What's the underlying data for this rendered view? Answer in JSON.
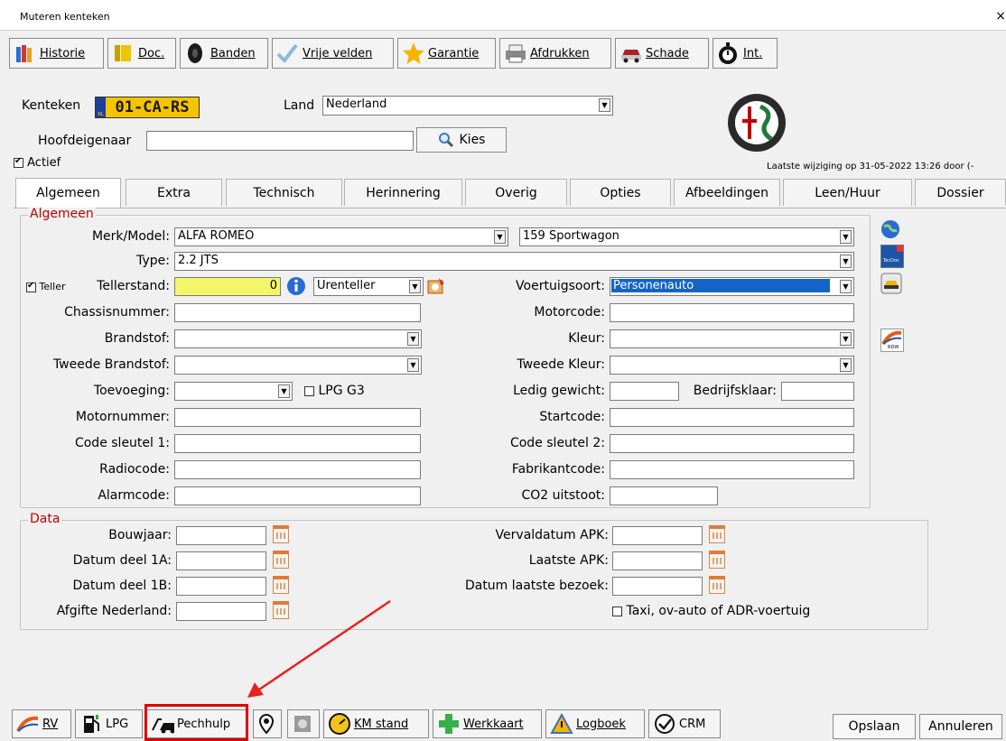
{
  "window": {
    "title": "Muteren kenteken",
    "close_glyph": "×"
  },
  "toolbar": {
    "items": [
      {
        "label": "Historie",
        "icon": "books-icon"
      },
      {
        "label": "Doc.",
        "icon": "binder-icon"
      },
      {
        "label": "Banden",
        "icon": "tire-icon"
      },
      {
        "label": "Vrije velden",
        "icon": "checkmark-icon"
      },
      {
        "label": "Garantie",
        "icon": "star-icon"
      },
      {
        "label": "Afdrukken",
        "icon": "printer-icon"
      },
      {
        "label": "Schade",
        "icon": "damaged-car-icon"
      },
      {
        "label": "Int.",
        "icon": "stopwatch-icon"
      }
    ]
  },
  "header": {
    "kenteken_label": "Kenteken",
    "plate_value": "01-CA-RS",
    "plate_country": "NL",
    "land_label": "Land",
    "land_value": "Nederland",
    "hoofdeigenaar_label": "Hoofdeigenaar",
    "hoofdeigenaar_value": "",
    "kies_label": "Kies",
    "actief_label": "Actief",
    "actief_checked": true,
    "laatste_wijziging": "Laatste wijziging op 31-05-2022 13:26 door (-"
  },
  "tabs": [
    "Algemeen",
    "Extra",
    "Technisch",
    "Herinnering",
    "Overig",
    "Opties",
    "Afbeeldingen",
    "Leen/Huur",
    "Dossier"
  ],
  "active_tab": "Algemeen",
  "algemeen": {
    "title": "Algemeen",
    "merk_model_label": "Merk/Model:",
    "merk_value": "ALFA ROMEO",
    "model_value": "159 Sportwagon",
    "type_label": "Type:",
    "type_value": "2.2 JTS",
    "teller_label": "Teller",
    "tellerstand_label": "Tellerstand:",
    "tellerstand_value": "0",
    "teller_type": "Urenteller",
    "voertuigsoort_label": "Voertuigsoort:",
    "voertuigsoort_value": "Personenauto",
    "chassisnummer_label": "Chassisnummer:",
    "motorcode_label": "Motorcode:",
    "brandstof_label": "Brandstof:",
    "kleur_label": "Kleur:",
    "tweede_brandstof_label": "Tweede Brandstof:",
    "tweede_kleur_label": "Tweede Kleur:",
    "toevoeging_label": "Toevoeging:",
    "lpg_g3_label": "LPG G3",
    "ledig_gewicht_label": "Ledig gewicht:",
    "bedrijfsklaar_label": "Bedrijfsklaar:",
    "motornummer_label": "Motornummer:",
    "startcode_label": "Startcode:",
    "code_sleutel1_label": "Code sleutel 1:",
    "code_sleutel2_label": "Code sleutel 2:",
    "radiocode_label": "Radiocode:",
    "fabrikantcode_label": "Fabrikantcode:",
    "alarmcode_label": "Alarmcode:",
    "co2_label": "CO2 uitstoot:"
  },
  "data_group": {
    "title": "Data",
    "bouwjaar_label": "Bouwjaar:",
    "datum1a_label": "Datum deel 1A:",
    "datum1b_label": "Datum deel 1B:",
    "afgifte_label": "Afgifte Nederland:",
    "vervaldatum_apk_label": "Vervaldatum APK:",
    "laatste_apk_label": "Laatste APK:",
    "laatste_bezoek_label": "Datum laatste bezoek:",
    "taxi_label": "Taxi, ov-auto of ADR-voertuig"
  },
  "side_icons": [
    "globe-icon",
    "tecdoc-icon",
    "car-service-icon",
    "rdw-icon"
  ],
  "side_icon_texts": {
    "tecdoc": "TecDoc",
    "rdw": "RDW"
  },
  "bottom_bar": {
    "items": [
      {
        "label": "RV",
        "icon": "rdw-icon"
      },
      {
        "label": "LPG",
        "icon": "fuel-pump-icon"
      },
      {
        "label": "Pechhulp",
        "icon": "tow-truck-icon"
      },
      {
        "label": "",
        "icon": "map-pin-icon"
      },
      {
        "label": "",
        "icon": "disk-icon"
      },
      {
        "label": "KM stand",
        "icon": "speedometer-icon"
      },
      {
        "label": "Werkkaart",
        "icon": "plus-icon"
      },
      {
        "label": "Logboek",
        "icon": "warning-icon"
      },
      {
        "label": "CRM",
        "icon": "check-badge-icon"
      }
    ],
    "opslaan": "Opslaan",
    "annuleren": "Annuleren"
  },
  "colors": {
    "highlight_box": "#e00000",
    "arrow": "#e82020",
    "group_title": "#c00000",
    "tellerstand_bg": "#f5f56a",
    "selected_bg": "#1464c8",
    "plate_bg": "#f5c400"
  }
}
